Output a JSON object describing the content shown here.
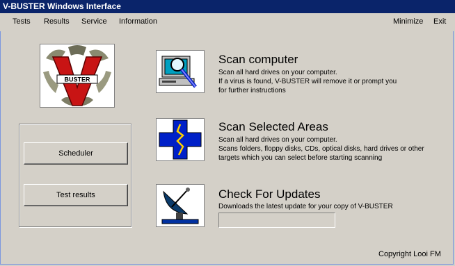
{
  "window": {
    "title": "V-BUSTER Windows Interface"
  },
  "menu": {
    "left_items": [
      {
        "label": "Tests"
      },
      {
        "label": "Results"
      },
      {
        "label": "Service"
      },
      {
        "label": "Information"
      }
    ],
    "right_items": [
      {
        "label": "Minimize"
      },
      {
        "label": "Exit"
      }
    ]
  },
  "logo": {
    "text": "BUSTER",
    "letter": "V",
    "icon": "v-buster-logo-icon"
  },
  "side_panel": {
    "scheduler_label": "Scheduler",
    "test_results_label": "Test results"
  },
  "actions": [
    {
      "title": "Scan computer",
      "description": "Scan all hard drives on your computer.\nIf a virus is found, V-BUSTER will remove it or prompt you\nfor further instructions",
      "icon": "computer-magnifier-icon"
    },
    {
      "title": "Scan Selected Areas",
      "description": "Scan all hard drives on your computer.\nScans folders, floppy disks, CDs, optical disks, hard drives or other\ntargets which you can select before starting scanning",
      "icon": "blue-cross-icon"
    },
    {
      "title": "Check For Updates",
      "description": "Downloads the latest update for your copy of V-BUSTER",
      "icon": "satellite-dish-icon"
    }
  ],
  "update_progress": {
    "value": 0
  },
  "footer": {
    "copyright": "Copyright Looi FM"
  }
}
